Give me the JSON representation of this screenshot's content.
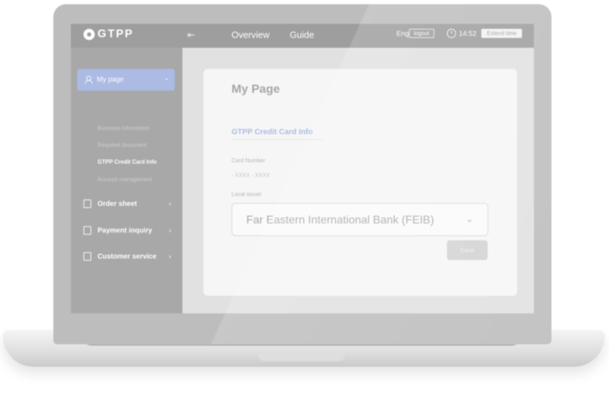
{
  "header": {
    "logo_text": "GTPP",
    "nav": [
      {
        "label": "Overview"
      },
      {
        "label": "Guide"
      }
    ],
    "language": "Eng",
    "login_label": "logout",
    "time": "14:52",
    "extend_label": "Extend time"
  },
  "sidebar": {
    "my_page": {
      "label": "My page",
      "submenu": [
        {
          "label": "Business information"
        },
        {
          "label": "Required document"
        },
        {
          "label": "GTPP Credit Card Info"
        },
        {
          "label": "Account management"
        }
      ]
    },
    "items": [
      {
        "label": "Order sheet"
      },
      {
        "label": "Payment inquiry"
      },
      {
        "label": "Customer service"
      }
    ]
  },
  "main": {
    "title": "My Page",
    "section_title": "GTPP Credit Card Info",
    "card_number_label": "Card Number",
    "card_number_value": "- XXXX - XXXX",
    "issuer_label": "Local issuer",
    "issuer_value": "Far Eastern International Bank (FEIB)",
    "save_label": "Save"
  },
  "colors": {
    "accent": "#abbbe3",
    "topbar": "#9e9e9e",
    "sidebar": "#a8a8a8",
    "lid": "#bdbdbd"
  }
}
